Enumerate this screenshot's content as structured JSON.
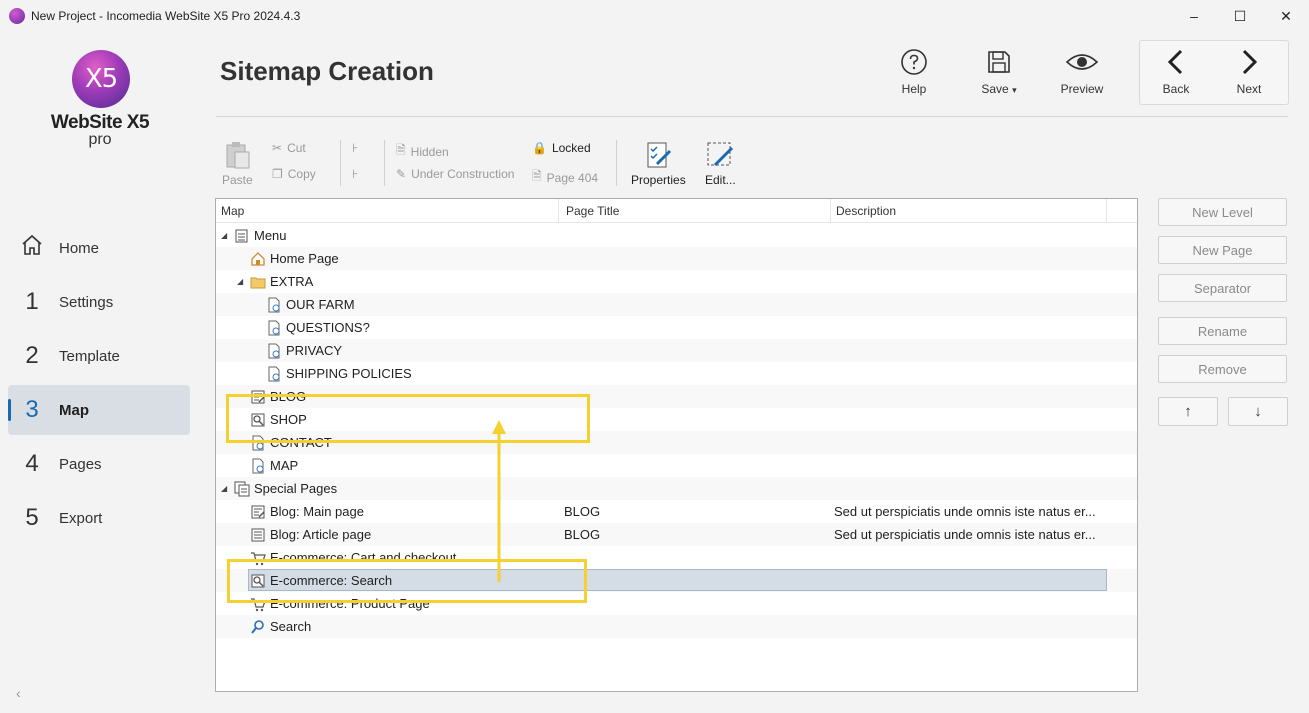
{
  "window": {
    "title": "New Project - Incomedia WebSite X5 Pro 2024.4.3"
  },
  "logo": {
    "mark": "X5",
    "brand": "WebSite X5",
    "edition": "pro"
  },
  "nav": [
    {
      "num": "",
      "label": "Home"
    },
    {
      "num": "1",
      "label": "Settings"
    },
    {
      "num": "2",
      "label": "Template"
    },
    {
      "num": "3",
      "label": "Map",
      "active": true
    },
    {
      "num": "4",
      "label": "Pages"
    },
    {
      "num": "5",
      "label": "Export"
    }
  ],
  "header": {
    "title": "Sitemap Creation",
    "help": "Help",
    "save": "Save",
    "save_arrow": "▾",
    "preview": "Preview",
    "back": "Back",
    "next": "Next"
  },
  "toolbar": {
    "paste": "Paste",
    "cut": "Cut",
    "copy": "Copy",
    "hidden": "Hidden",
    "under_construction": "Under Construction",
    "locked": "Locked",
    "page404": "Page 404",
    "properties": "Properties",
    "edit": "Edit..."
  },
  "tree": {
    "columns": [
      "Map",
      "Page Title",
      "Description"
    ],
    "rows": [
      {
        "label": "Menu",
        "title": "",
        "desc": ""
      },
      {
        "label": "Home Page",
        "title": "",
        "desc": ""
      },
      {
        "label": "EXTRA",
        "title": "",
        "desc": ""
      },
      {
        "label": "OUR FARM",
        "title": "",
        "desc": ""
      },
      {
        "label": "QUESTIONS?",
        "title": "",
        "desc": ""
      },
      {
        "label": "PRIVACY",
        "title": "",
        "desc": ""
      },
      {
        "label": "SHIPPING POLICIES",
        "title": "",
        "desc": ""
      },
      {
        "label": "BLOG",
        "title": "",
        "desc": ""
      },
      {
        "label": "SHOP",
        "title": "",
        "desc": ""
      },
      {
        "label": "CONTACT",
        "title": "",
        "desc": ""
      },
      {
        "label": "MAP",
        "title": "",
        "desc": ""
      },
      {
        "label": "Special Pages",
        "title": "",
        "desc": ""
      },
      {
        "label": "Blog: Main page",
        "title": "BLOG",
        "desc": "Sed ut perspiciatis unde omnis iste natus er..."
      },
      {
        "label": "Blog: Article page",
        "title": "BLOG",
        "desc": "Sed ut perspiciatis unde omnis iste natus er..."
      },
      {
        "label": "E-commerce: Cart and checkout",
        "title": "",
        "desc": ""
      },
      {
        "label": "E-commerce: Search",
        "title": "",
        "desc": ""
      },
      {
        "label": "E-commerce: Product Page",
        "title": "",
        "desc": ""
      },
      {
        "label": "Search",
        "title": "",
        "desc": ""
      }
    ]
  },
  "side_buttons": {
    "new_level": "New Level",
    "new_page": "New Page",
    "separator": "Separator",
    "rename": "Rename",
    "remove": "Remove",
    "up": "↑",
    "down": "↓"
  },
  "colors": {
    "accent": "#1b6ab0",
    "highlight": "#f5d130",
    "selection": "#d4dce6"
  }
}
